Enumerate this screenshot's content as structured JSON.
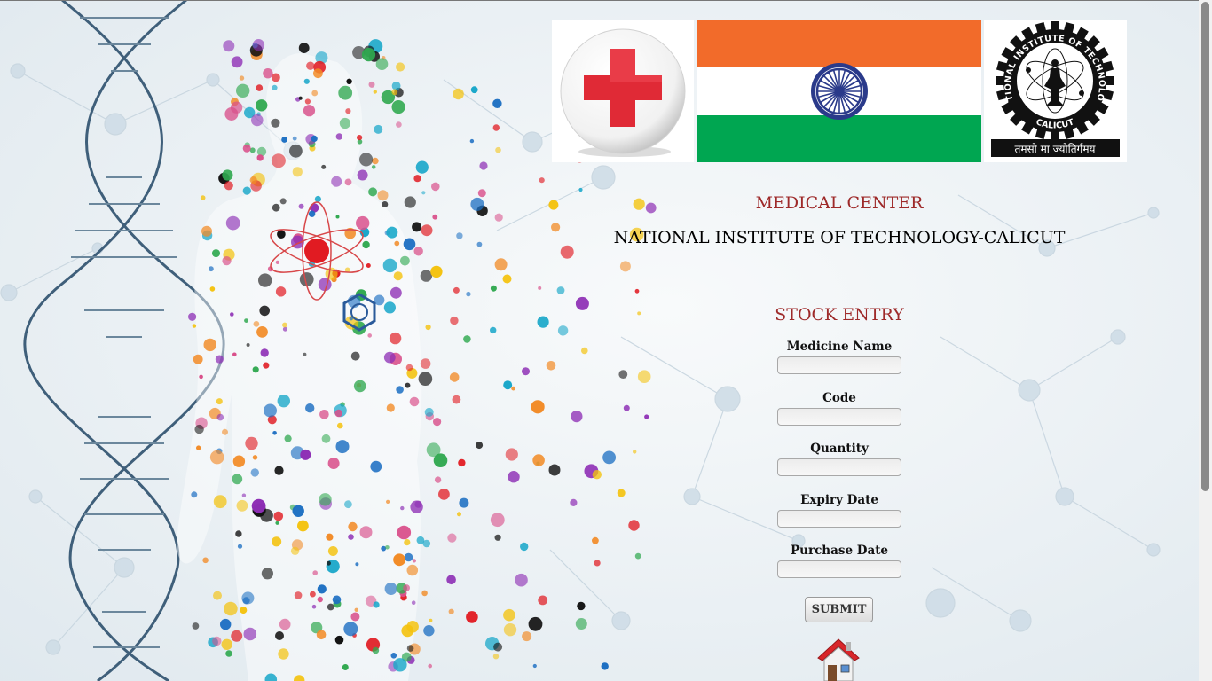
{
  "header": {
    "subtitle": "MEDICAL CENTER",
    "institute": "NATIONAL INSTITUTE OF TECHNOLOGY-CALICUT"
  },
  "nit_logo": {
    "motto": "तमसो मा ज्योतिर्गमय"
  },
  "form": {
    "title": "STOCK ENTRY",
    "fields": [
      {
        "label": "Medicine Name",
        "value": ""
      },
      {
        "label": "Code",
        "value": ""
      },
      {
        "label": "Quantity",
        "value": ""
      },
      {
        "label": "Expiry Date",
        "value": ""
      },
      {
        "label": "Purchase Date",
        "value": ""
      }
    ],
    "submit_label": "SUBMIT"
  },
  "icons": {
    "red_cross": "red-cross-icon",
    "flag": "india-flag",
    "home": "home-icon"
  },
  "colors": {
    "title_red": "#9e2a2a",
    "cross_red": "#e02a36",
    "flag_saffron": "#f26b2a",
    "flag_green": "#00a651",
    "chakra_navy": "#2a3a8a"
  }
}
